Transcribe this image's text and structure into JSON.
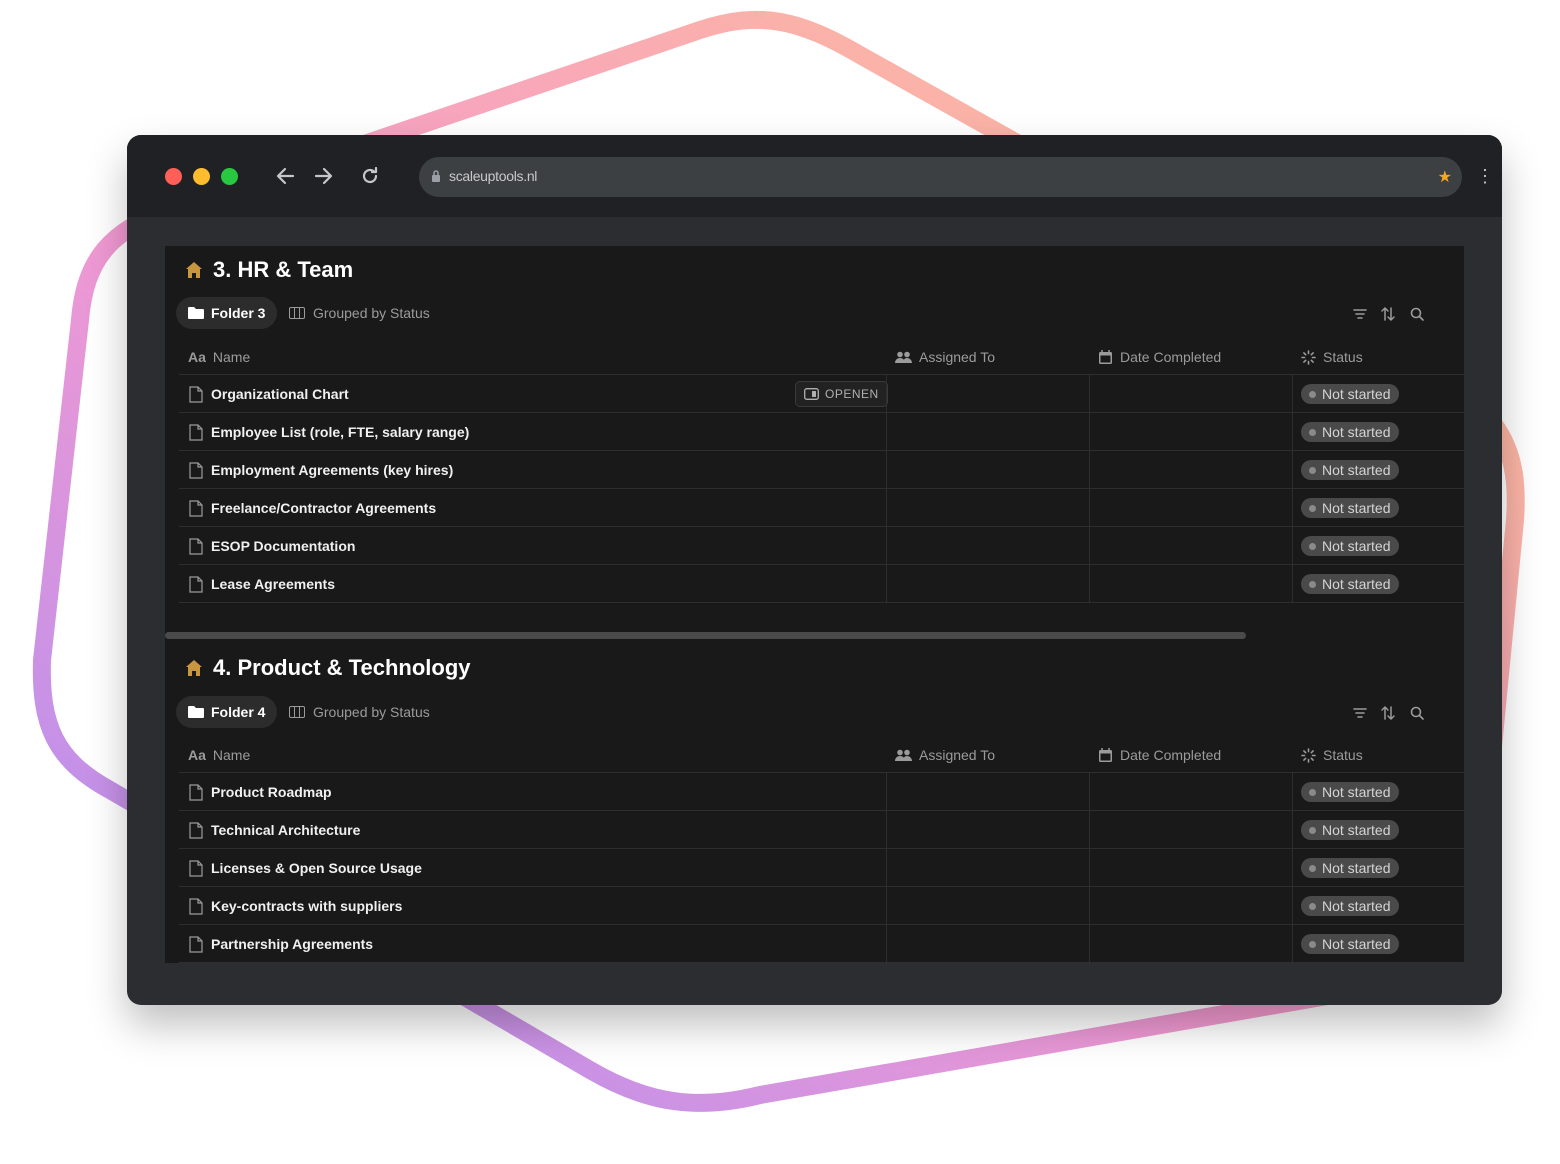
{
  "browser": {
    "url": "scaleuptools.nl",
    "colors": {
      "close": "#ff5f57",
      "minimize": "#febc2e",
      "maximize": "#28c840",
      "star": "#f5a623"
    }
  },
  "columns": {
    "name": "Name",
    "assigned": "Assigned To",
    "date": "Date Completed",
    "status": "Status"
  },
  "open_button": "OPENEN",
  "sections": [
    {
      "title": "3. HR & Team",
      "folder": "Folder 3",
      "view": "Grouped by Status",
      "rows": [
        {
          "name": "Organizational Chart",
          "status": "Not started"
        },
        {
          "name": "Employee List (role, FTE, salary range)",
          "status": "Not started"
        },
        {
          "name": "Employment Agreements (key hires)",
          "status": "Not started"
        },
        {
          "name": "Freelance/Contractor Agreements",
          "status": "Not started"
        },
        {
          "name": "ESOP Documentation",
          "status": "Not started"
        },
        {
          "name": "Lease Agreements",
          "status": "Not started"
        }
      ]
    },
    {
      "title": "4. Product & Technology",
      "folder": "Folder 4",
      "view": "Grouped by Status",
      "rows": [
        {
          "name": "Product Roadmap",
          "status": "Not started"
        },
        {
          "name": "Technical Architecture",
          "status": "Not started"
        },
        {
          "name": "Licenses & Open Source Usage",
          "status": "Not started"
        },
        {
          "name": "Key-contracts with suppliers",
          "status": "Not started"
        },
        {
          "name": "Partnership Agreements",
          "status": "Not started"
        }
      ]
    }
  ]
}
